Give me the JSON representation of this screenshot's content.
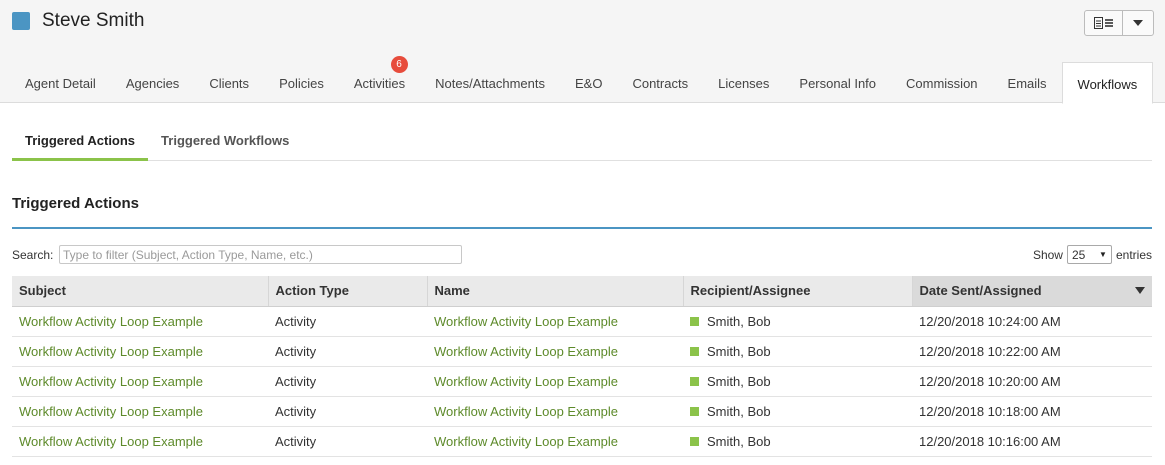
{
  "header": {
    "title": "Steve Smith",
    "accent_color": "#4b95c3"
  },
  "toolbar": {
    "view_icon": "document-list-icon",
    "dropdown_icon": "caret-down-icon"
  },
  "tabs": [
    {
      "label": "Agent Detail"
    },
    {
      "label": "Agencies"
    },
    {
      "label": "Clients"
    },
    {
      "label": "Policies"
    },
    {
      "label": "Activities",
      "badge": "6"
    },
    {
      "label": "Notes/Attachments"
    },
    {
      "label": "E&O"
    },
    {
      "label": "Contracts"
    },
    {
      "label": "Licenses"
    },
    {
      "label": "Personal Info"
    },
    {
      "label": "Commission"
    },
    {
      "label": "Emails"
    },
    {
      "label": "Workflows",
      "active": true
    }
  ],
  "subtabs": [
    {
      "label": "Triggered Actions",
      "active": true
    },
    {
      "label": "Triggered Workflows"
    }
  ],
  "section": {
    "title": "Triggered Actions"
  },
  "search": {
    "label": "Search:",
    "placeholder": "Type to filter (Subject, Action Type, Name, etc.)",
    "value": ""
  },
  "pagination": {
    "show_label": "Show",
    "page_size": "25",
    "entries_label": "entries"
  },
  "table": {
    "columns": [
      "Subject",
      "Action Type",
      "Name",
      "Recipient/Assignee",
      "Date Sent/Assigned"
    ],
    "sorted_column": "Date Sent/Assigned",
    "sort_direction": "descending",
    "status_color": "#8bc34a",
    "rows": [
      {
        "subject": "Workflow Activity Loop Example",
        "action_type": "Activity",
        "name": "Workflow Activity Loop Example",
        "recipient": "Smith, Bob",
        "date": "12/20/2018 10:24:00 AM"
      },
      {
        "subject": "Workflow Activity Loop Example",
        "action_type": "Activity",
        "name": "Workflow Activity Loop Example",
        "recipient": "Smith, Bob",
        "date": "12/20/2018 10:22:00 AM"
      },
      {
        "subject": "Workflow Activity Loop Example",
        "action_type": "Activity",
        "name": "Workflow Activity Loop Example",
        "recipient": "Smith, Bob",
        "date": "12/20/2018 10:20:00 AM"
      },
      {
        "subject": "Workflow Activity Loop Example",
        "action_type": "Activity",
        "name": "Workflow Activity Loop Example",
        "recipient": "Smith, Bob",
        "date": "12/20/2018 10:18:00 AM"
      },
      {
        "subject": "Workflow Activity Loop Example",
        "action_type": "Activity",
        "name": "Workflow Activity Loop Example",
        "recipient": "Smith, Bob",
        "date": "12/20/2018 10:16:00 AM"
      }
    ]
  }
}
